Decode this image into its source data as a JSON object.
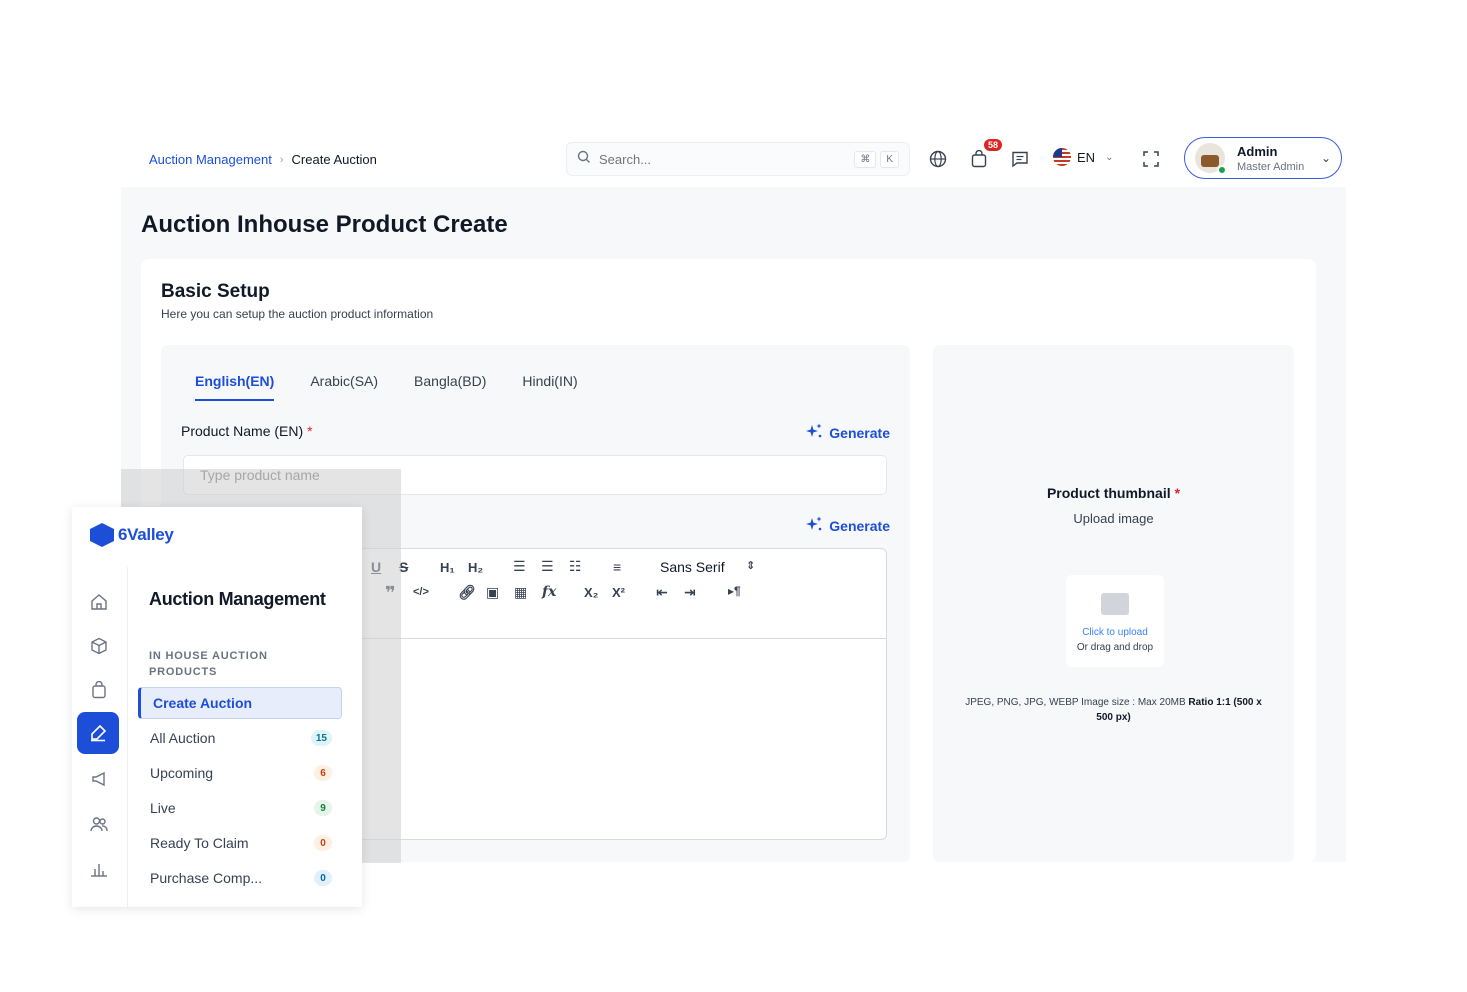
{
  "breadcrumb": {
    "parent": "Auction Management",
    "current": "Create Auction"
  },
  "search": {
    "placeholder": "Search...",
    "shortcut_key1": "⌘",
    "shortcut_key2": "K"
  },
  "header": {
    "cart_badge": "58",
    "language": "EN",
    "user_name": "Admin",
    "user_role": "Master Admin"
  },
  "page": {
    "title": "Auction Inhouse Product Create"
  },
  "basic_setup": {
    "title": "Basic Setup",
    "subtitle": "Here you can setup the auction product information",
    "tabs": [
      {
        "label": "English(EN)",
        "active": true
      },
      {
        "label": "Arabic(SA)",
        "active": false
      },
      {
        "label": "Bangla(BD)",
        "active": false
      },
      {
        "label": "Hindi(IN)",
        "active": false
      }
    ],
    "product_name_label": "Product Name (EN)",
    "required_mark": "*",
    "product_name_placeholder": "Type product name",
    "generate_label": "Generate",
    "editor": {
      "font_select": "Sans Serif"
    }
  },
  "thumbnail": {
    "title": "Product thumbnail",
    "required_mark": "*",
    "subtitle": "Upload image",
    "click_text": "Click to upload",
    "drag_text": "Or drag and drop",
    "format_text": "JPEG, PNG, JPG, WEBP Image size : Max 20MB",
    "ratio_text": "Ratio 1:1 (500 x 500 px)"
  },
  "sidebar": {
    "brand": "6Valley",
    "title": "Auction Management",
    "section_label": "IN HOUSE AUCTION PRODUCTS",
    "items": [
      {
        "label": "Create Auction",
        "count": "",
        "active": true
      },
      {
        "label": "All Auction",
        "count": "15",
        "color": "#0e7490",
        "bg": "#dff4f8"
      },
      {
        "label": "Upcoming",
        "count": "6",
        "color": "#c2410c",
        "bg": "#fdf0e3"
      },
      {
        "label": "Live",
        "count": "9",
        "color": "#15803d",
        "bg": "#e5f5ea"
      },
      {
        "label": "Ready To Claim",
        "count": "0",
        "color": "#c2410c",
        "bg": "#fdf0e3"
      },
      {
        "label": "Purchase Comp...",
        "count": "0",
        "color": "#0369a1",
        "bg": "#e2f0fb"
      }
    ]
  },
  "colors": {
    "accent": "#1d4ed8",
    "danger": "#dc2626"
  }
}
